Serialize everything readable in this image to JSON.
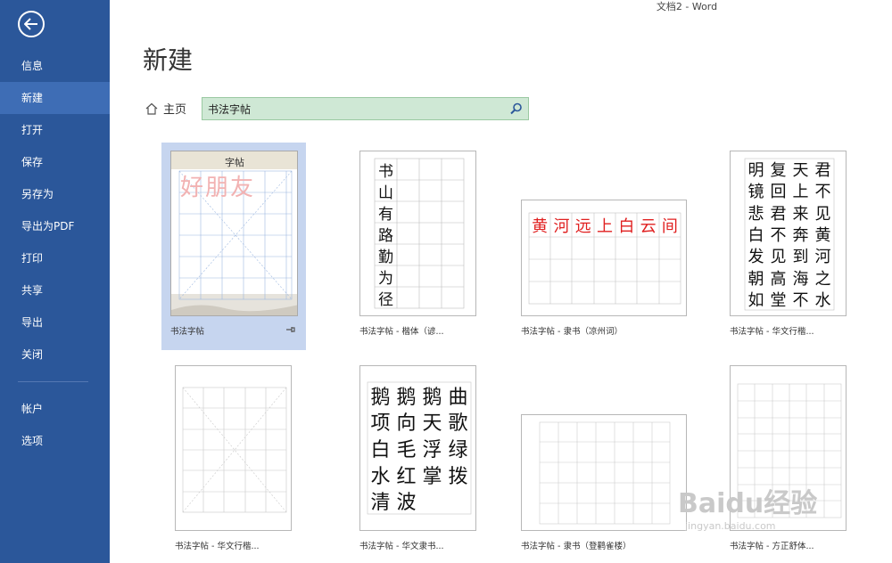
{
  "window": {
    "title": "文档2 - Word"
  },
  "sidebar": {
    "items": [
      {
        "label": "信息"
      },
      {
        "label": "新建"
      },
      {
        "label": "打开"
      },
      {
        "label": "保存"
      },
      {
        "label": "另存为"
      },
      {
        "label": "导出为PDF"
      },
      {
        "label": "打印"
      },
      {
        "label": "共享"
      },
      {
        "label": "导出"
      },
      {
        "label": "关闭"
      }
    ],
    "bottom_items": [
      {
        "label": "帐户"
      },
      {
        "label": "选项"
      }
    ],
    "active": "新建",
    "accent": "#2b579a"
  },
  "main": {
    "title": "新建",
    "breadcrumb": {
      "home_label": "主页"
    },
    "search": {
      "value": "书法字帖"
    }
  },
  "templates": [
    {
      "label": "书法字帖",
      "selected": true,
      "header_text": "字帖",
      "overlay_text": "好朋友"
    },
    {
      "label": "书法字帖 - 楷体（谚...",
      "chars": [
        "书",
        "山",
        "有",
        "路",
        "勤",
        "为",
        "径"
      ]
    },
    {
      "label": "书法字帖 - 隶书（凉州词）",
      "chars": [
        "黄",
        "河",
        "远",
        "上",
        "白",
        "云",
        "间"
      ]
    },
    {
      "label": "书法字帖 - 华文行楷...",
      "chars": [
        "明",
        "复",
        "天",
        "君",
        "镜",
        "回",
        "上",
        "不",
        "悲",
        "君",
        "来",
        "见",
        "白",
        "不",
        "奔",
        "黄",
        "发",
        "见",
        "到",
        "河",
        "朝",
        "高",
        "海",
        "之",
        "如",
        "堂",
        "不",
        "水"
      ]
    },
    {
      "label": "书法字帖 - 华文行楷..."
    },
    {
      "label": "书法字帖 - 华文隶书...",
      "chars": [
        "鹅",
        "鹅",
        "鹅",
        "曲",
        "项",
        "向",
        "天",
        "歌",
        "白",
        "毛",
        "浮",
        "绿",
        "水",
        "红",
        "掌",
        "拨",
        "清",
        "波"
      ]
    },
    {
      "label": "书法字帖 - 隶书（登鹳雀楼）"
    },
    {
      "label": "书法字帖 - 方正舒体..."
    }
  ],
  "watermark": {
    "text": "Baidu经验",
    "sub": "jingyan.baidu.com"
  }
}
